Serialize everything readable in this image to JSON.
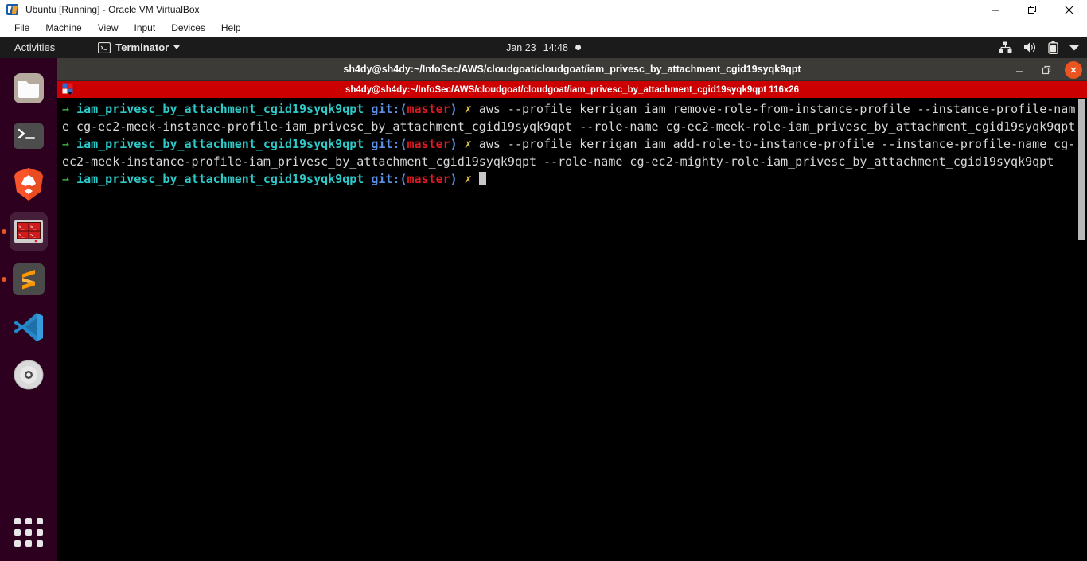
{
  "host": {
    "title": "Ubuntu [Running] - Oracle VM VirtualBox",
    "logo_icon": "virtualbox-logo-icon",
    "window_buttons": [
      {
        "name": "minimize-button",
        "glyph": "minimize-icon"
      },
      {
        "name": "restore-button",
        "glyph": "restore-icon"
      },
      {
        "name": "close-button",
        "glyph": "close-icon"
      }
    ],
    "menu": [
      {
        "label": "File"
      },
      {
        "label": "Machine"
      },
      {
        "label": "View"
      },
      {
        "label": "Input"
      },
      {
        "label": "Devices"
      },
      {
        "label": "Help"
      }
    ]
  },
  "topbar": {
    "activities": "Activities",
    "app_menu": {
      "icon": "terminal-app-icon",
      "label": "Terminator",
      "arrow": "chevron-down-icon"
    },
    "clock": {
      "date": "Jan 23",
      "time": "14:48",
      "notification_indicator": "notification-dot"
    },
    "tray": [
      {
        "name": "network-icon"
      },
      {
        "name": "volume-icon"
      },
      {
        "name": "battery-icon"
      },
      {
        "name": "system-menu-chevron-icon"
      }
    ]
  },
  "dock": {
    "items": [
      {
        "name": "dock-item-files",
        "icon": "files-folder-icon",
        "running": false,
        "active": false
      },
      {
        "name": "dock-item-terminal",
        "icon": "terminal-prompt-icon",
        "running": false,
        "active": false
      },
      {
        "name": "dock-item-brave",
        "icon": "brave-lion-icon",
        "running": false,
        "active": false
      },
      {
        "name": "dock-item-terminator",
        "icon": "terminator-grid-icon",
        "running": true,
        "active": true
      },
      {
        "name": "dock-item-sublime-text",
        "icon": "sublime-text-icon",
        "running": true,
        "active": false
      },
      {
        "name": "dock-item-vscode",
        "icon": "vscode-icon",
        "running": false,
        "active": false
      },
      {
        "name": "dock-item-disc",
        "icon": "optical-disc-icon",
        "running": false,
        "active": false
      }
    ],
    "show_apps": {
      "name": "show-applications-button",
      "icon": "app-grid-icon"
    }
  },
  "terminal": {
    "window_title": "sh4dy@sh4dy:~/InfoSec/AWS/cloudgoat/cloudgoat/iam_privesc_by_attachment_cgid19syqk9qpt",
    "window_buttons": [
      {
        "name": "terminal-minimize-button",
        "glyph": "minimize-icon"
      },
      {
        "name": "terminal-maximize-button",
        "glyph": "restore-icon"
      },
      {
        "name": "terminal-close-button",
        "glyph": "close-icon"
      }
    ],
    "tab": {
      "icon": "terminator-layout-icon",
      "title": "sh4dy@sh4dy:~/InfoSec/AWS/cloudgoat/cloudgoat/iam_privesc_by_attachment_cgid19syqk9qpt 116x26",
      "size": "116x26"
    },
    "colors": {
      "tab_bar": "#cc0000",
      "title_bar": "#3c3b37",
      "background": "#000000",
      "close_button": "#e95420",
      "prompt_arrow": "#4ec94e",
      "prompt_dir": "#2ec9c9",
      "prompt_git": "#5c8fe6",
      "prompt_branch": "#e01b24",
      "prompt_status": "#e8c547",
      "foreground": "#d8d8d8"
    },
    "prompt": {
      "arrow": "→",
      "directory": "iam_privesc_by_attachment_cgid19syqk9qpt",
      "git_prefix": "git:(",
      "git_branch": "master",
      "git_suffix": ")",
      "status_glyph": "✗"
    },
    "entries": [
      {
        "command": "aws --profile kerrigan iam remove-role-from-instance-profile --instance-profile-name cg-ec2-meek-instance-profile-iam_privesc_by_attachment_cgid19syqk9qpt --role-name cg-ec2-meek-role-iam_privesc_by_attachment_cgid19syqk9qpt",
        "output": ""
      },
      {
        "command": "aws --profile kerrigan iam add-role-to-instance-profile --instance-profile-name cg-ec2-meek-instance-profile-iam_privesc_by_attachment_cgid19syqk9qpt --role-name cg-ec2-mighty-role-iam_privesc_by_attachment_cgid19syqk9qpt",
        "output": ""
      }
    ],
    "cursor": "block"
  }
}
